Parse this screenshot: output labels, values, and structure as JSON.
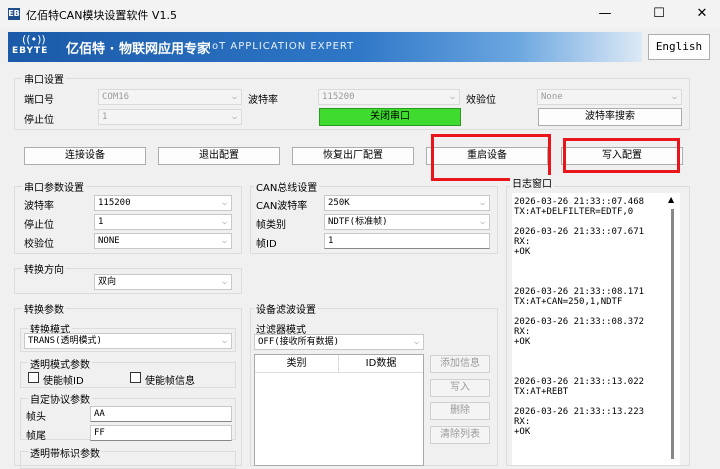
{
  "window": {
    "title": "亿佰特CAN模块设置软件 V1.5",
    "app_icon": "EB"
  },
  "banner": {
    "logo": "EBYTE",
    "slogan": "亿佰特 · 物联网应用专家",
    "slogan_en": "IoT APPLICATION EXPERT"
  },
  "lang_button": "English",
  "serial": {
    "group_label": "串口设置",
    "port_label": "端口号",
    "port_value": "COM16",
    "baud_label": "波特率",
    "baud_value": "115200",
    "parity_label": "效验位",
    "parity_value": "None",
    "stop_label": "停止位",
    "stop_value": "1",
    "close_button": "关闭串口",
    "search_button": "波特率搜索"
  },
  "actions": {
    "connect": "连接设备",
    "exit_config": "退出配置",
    "restore": "恢复出厂配置",
    "restart": "重启设备",
    "write": "写入配置"
  },
  "serial_params": {
    "group_label": "串口参数设置",
    "baud_label": "波特率",
    "baud_value": "115200",
    "stop_label": "停止位",
    "stop_value": "1",
    "parity_label": "校验位",
    "parity_value": "NONE"
  },
  "can_bus": {
    "group_label": "CAN总线设置",
    "baud_label": "CAN波特率",
    "baud_value": "250K",
    "frame_label": "帧类别",
    "frame_value": "NDTF(标准帧)",
    "id_label": "帧ID",
    "id_value": "1"
  },
  "direction": {
    "group_label": "转换方向",
    "value": "双向"
  },
  "conversion": {
    "group_label": "转换参数",
    "mode_label": "转换模式",
    "mode_value": "TRANS(透明模式)",
    "transparent_label": "透明模式参数",
    "enable_frame_id": "使能帧ID",
    "enable_frame_info": "使能帧信息",
    "custom_label": "自定协议参数",
    "head_label": "帧头",
    "head_value": "AA",
    "tail_label": "帧尾",
    "tail_value": "FF",
    "marker_label": "透明带标识参数"
  },
  "filter": {
    "group_label": "设备滤波设置",
    "mode_label": "过滤器模式",
    "mode_value": "OFF(接收所有数据)",
    "col_type": "类别",
    "col_id": "ID数据",
    "add_button": "添加信息",
    "write_button": "写入",
    "delete_button": "删除",
    "clear_button": "清除列表"
  },
  "log": {
    "group_label": "日志窗口",
    "lines": [
      "2026-03-26 21:33::07.468",
      "TX:AT+DELFILTER=EDTF,0",
      "",
      "2026-03-26 21:33::07.671",
      "RX:",
      "+OK",
      "",
      "",
      "",
      "2026-03-26 21:33::08.171",
      "TX:AT+CAN=250,1,NDTF",
      "",
      "2026-03-26 21:33::08.372",
      "RX:",
      "+OK",
      "",
      "",
      "",
      "2026-03-26 21:33::13.022",
      "TX:AT+REBT",
      "",
      "2026-03-26 21:33::13.223",
      "RX:",
      "+OK"
    ]
  },
  "colors": {
    "highlight": "#e8151b",
    "open_button": "#3fdc2f",
    "banner": "#1a5aa8"
  }
}
